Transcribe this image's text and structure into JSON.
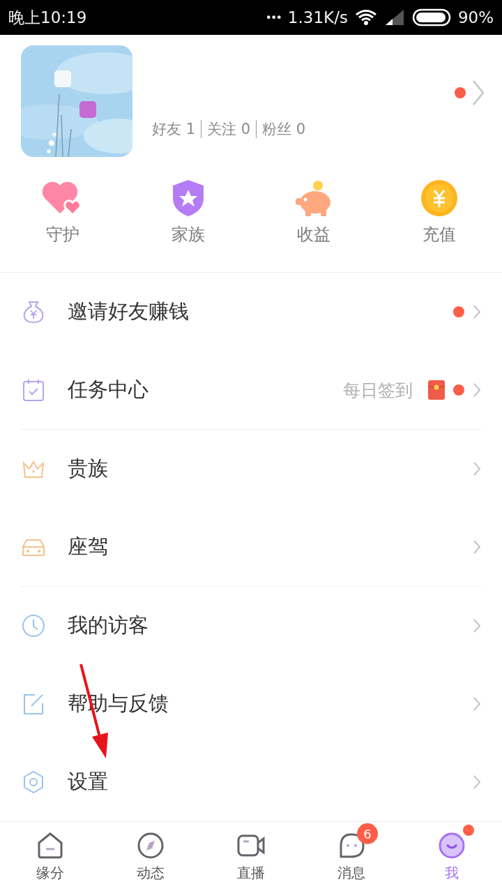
{
  "status_bar": {
    "time": "晚上10:19",
    "dots": "•••",
    "speed": "1.31K/s",
    "battery": "90%"
  },
  "profile": {
    "avatar": {
      "kind": "picture"
    },
    "dot": true,
    "stats": [
      "好友 1",
      "关注 0",
      "粉丝 0"
    ]
  },
  "shortcuts": [
    {
      "label": "守护"
    },
    {
      "label": "家族"
    },
    {
      "label": "收益"
    },
    {
      "label": "充值"
    }
  ],
  "menu_groups": [
    [
      {
        "label": "邀请好友赚钱",
        "red_packet": false,
        "dot": true
      },
      {
        "label": "任务中心",
        "hint": "每日签到",
        "red_packet": true,
        "dot": true
      }
    ],
    [
      {
        "label": "贵族",
        "red_packet": false,
        "dot": false
      },
      {
        "label": "座驾",
        "red_packet": false,
        "dot": false
      }
    ],
    [
      {
        "label": "我的访客",
        "red_packet": false,
        "dot": false
      },
      {
        "label": "帮助与反馈",
        "red_packet": false,
        "dot": false
      },
      {
        "label": "设置",
        "red_packet": false,
        "dot": false
      }
    ]
  ],
  "tab_bar": [
    {
      "label": "缘分",
      "selected": false,
      "dot": false
    },
    {
      "label": "动态",
      "selected": false,
      "dot": false
    },
    {
      "label": "直播",
      "selected": false,
      "dot": false
    },
    {
      "label": "消息",
      "selected": false,
      "badge": "6",
      "dot": false
    },
    {
      "label": "我",
      "selected": true,
      "dot": true
    }
  ]
}
